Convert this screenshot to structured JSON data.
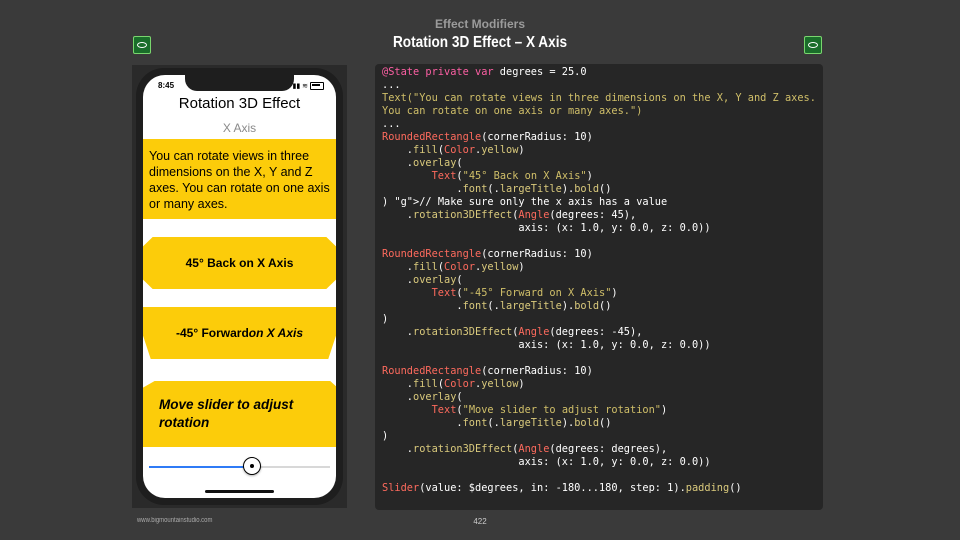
{
  "header": {
    "section": "Effect Modifiers",
    "title": "Rotation 3D Effect – X Axis"
  },
  "phone": {
    "time": "8:45",
    "title": "Rotation 3D Effect",
    "subtitle": "X Axis",
    "description": "You can rotate views in three dimensions on the X, Y and Z axes. You can rotate on one axis or many axes.",
    "card1": "45° Back on X Axis",
    "card2_a": "-45° Forward ",
    "card2_b": "on X Axis",
    "card3": "Move slider to adjust rotation",
    "slider_value": 25,
    "slider_range": [
      -180,
      180
    ]
  },
  "code": {
    "lines": [
      "@State private var degrees = 25.0",
      "...",
      "Text(\"You can rotate views in three dimensions on the X, Y and Z axes.",
      "You can rotate on one axis or many axes.\")",
      "...",
      "RoundedRectangle(cornerRadius: 10)",
      "    .fill(Color.yellow)",
      "    .overlay(",
      "        Text(\"45° Back on X Axis\")",
      "            .font(.largeTitle).bold()",
      ") // Make sure only the x axis has a value",
      "    .rotation3DEffect(Angle(degrees: 45),",
      "                      axis: (x: 1.0, y: 0.0, z: 0.0))",
      "",
      "RoundedRectangle(cornerRadius: 10)",
      "    .fill(Color.yellow)",
      "    .overlay(",
      "        Text(\"-45° Forward on X Axis\")",
      "            .font(.largeTitle).bold()",
      ")",
      "    .rotation3DEffect(Angle(degrees: -45),",
      "                      axis: (x: 1.0, y: 0.0, z: 0.0))",
      "",
      "RoundedRectangle(cornerRadius: 10)",
      "    .fill(Color.yellow)",
      "    .overlay(",
      "        Text(\"Move slider to adjust rotation\")",
      "            .font(.largeTitle).bold()",
      ")",
      "    .rotation3DEffect(Angle(degrees: degrees),",
      "                      axis: (x: 1.0, y: 0.0, z: 0.0))",
      "",
      "Slider(value: $degrees, in: -180...180, step: 1).padding()"
    ]
  },
  "footer": {
    "site": "www.bigmountainstudio.com",
    "page": "422"
  },
  "colors": {
    "accent_yellow": "#fccc0a",
    "slider_blue": "#2f7bf6",
    "badge_green": "#1a6d2a"
  },
  "icons": {
    "badge": "green-badge-icon",
    "battery": "battery-icon",
    "wifi": "wifi-icon"
  }
}
